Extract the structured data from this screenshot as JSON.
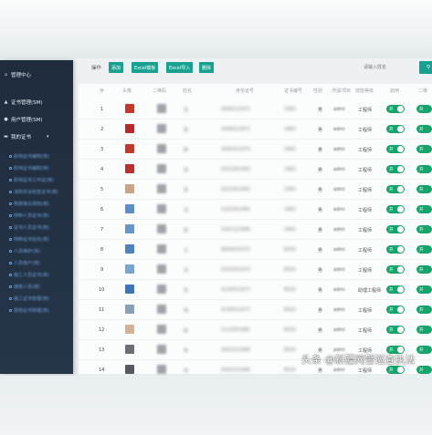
{
  "sidebar": {
    "items": [
      {
        "label": "管理中心",
        "icon": "home-icon"
      },
      {
        "label": "证书管理(SM)",
        "icon": "certificate-icon"
      },
      {
        "label": "用户管理(SM)",
        "icon": "user-icon"
      },
      {
        "label": "我的证书",
        "icon": "folder-icon",
        "expanded": true
      }
    ],
    "sub_items": [
      "影响证书编制(用)",
      "影响证书编制(用)",
      "影响证书工作证(用)",
      "消防安全检查证书(用)",
      "制度接合场地(用)",
      "特种人员证书(用)",
      "证书人员证书(用)",
      "特种证书信息(用)",
      "人员维护(用)",
      "人员用户(用)",
      "施工人员证书(用)",
      "维修人员(用)",
      "施工证书管理(用)",
      "其他证书管理(用)"
    ]
  },
  "toolbar": {
    "label": "操作",
    "add": "添加",
    "excel_template": "Excel模板",
    "excel_import": "Excel导入",
    "delete": "删除",
    "search_placeholder": "请输入姓名",
    "search_button": "搜索"
  },
  "table": {
    "headers": [
      "序",
      "头像",
      "二维码",
      "姓名",
      "身份证号",
      "证书编号",
      "性别",
      "所属项目",
      "技能等级",
      "启用",
      "二维"
    ],
    "rows": [
      {
        "no": "1",
        "name": "任",
        "id": "4306211972",
        "cert": "1963",
        "gender": "男",
        "owner": "admi",
        "role": "工程师",
        "avatar": "#c0392b"
      },
      {
        "no": "2",
        "name": "张",
        "id": "4306021971",
        "cert": "1963",
        "gender": "男",
        "owner": "admi",
        "role": "工程师",
        "avatar": "#b52a2a"
      },
      {
        "no": "3",
        "name": "陈",
        "id": "4306311970",
        "cert": "1963",
        "gender": "男",
        "owner": "admi",
        "role": "工程师",
        "avatar": "#c0392b"
      },
      {
        "no": "4",
        "name": "宋",
        "id": "5323261963",
        "cert": "1963",
        "gender": "男",
        "owner": "admi",
        "role": "工程师",
        "avatar": "#b83030"
      },
      {
        "no": "5",
        "name": "李",
        "id": "5323261963",
        "cert": "1963",
        "gender": "男",
        "owner": "admi",
        "role": "工程师",
        "avatar": "#c9a38a"
      },
      {
        "no": "6",
        "name": "冯",
        "id": "5323261963",
        "cert": "1963",
        "gender": "男",
        "owner": "admi",
        "role": "工程师",
        "avatar": "#5b8fc6"
      },
      {
        "no": "7",
        "name": "赵",
        "id": "5301121986",
        "cert": "1963",
        "gender": "男",
        "owner": "admi",
        "role": "工程师",
        "avatar": "#6a95c7"
      },
      {
        "no": "8",
        "name": "王",
        "id": "8600031972",
        "cert": "8020",
        "gender": "男",
        "owner": "admi",
        "role": "工程师",
        "avatar": "#4d82c0"
      },
      {
        "no": "9",
        "name": "刘",
        "id": "5324261970",
        "cert": "8020",
        "gender": "男",
        "owner": "admi",
        "role": "工程师",
        "avatar": "#7aa4d0"
      },
      {
        "no": "10",
        "name": "孙",
        "id": "4130011977",
        "cert": "8020",
        "gender": "男",
        "owner": "admi",
        "role": "助理工程师",
        "avatar": "#3d75b8"
      },
      {
        "no": "11",
        "name": "钱",
        "id": "4130011977",
        "cert": "8020",
        "gender": "男",
        "owner": "admi",
        "role": "工程师",
        "avatar": "#8aa0b8"
      },
      {
        "no": "12",
        "name": "赵",
        "id": "5123301985",
        "cert": "8020",
        "gender": "男",
        "owner": "admi",
        "role": "工程师",
        "avatar": "#d3b29a"
      },
      {
        "no": "13",
        "name": "朱",
        "id": "5002221966",
        "cert": "8020",
        "gender": "男",
        "owner": "admi",
        "role": "工程师",
        "avatar": "#6a6f75"
      },
      {
        "no": "14",
        "name": "何",
        "id": "5002221966",
        "cert": "8020",
        "gender": "男",
        "owner": "admi",
        "role": "工程师",
        "avatar": "#555a60"
      }
    ],
    "toggle_label": "开"
  },
  "watermark": "头条 @新疆网警巡查执法",
  "colors": {
    "sidebar_bg": "#1f2c3c",
    "accent": "#1aa08f",
    "toggle_on": "#17a36c",
    "submenu_text": "#6f9ed6"
  }
}
